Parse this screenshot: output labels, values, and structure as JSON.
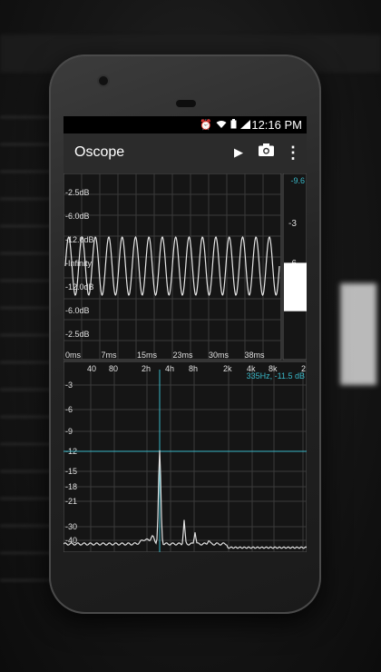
{
  "status_bar": {
    "time": "12:16 PM",
    "icons": [
      "alarm-icon",
      "wifi-icon",
      "battery-icon",
      "signal-icon"
    ]
  },
  "app_bar": {
    "title": "Oscope",
    "actions": [
      {
        "name": "play-icon",
        "glyph": "▶"
      },
      {
        "name": "camera-icon",
        "glyph": "📷"
      },
      {
        "name": "overflow-menu-icon",
        "glyph": "⋮"
      }
    ]
  },
  "scope": {
    "amplitude_labels": [
      "-2.5dB",
      "-6.0dB",
      "-12.0dB",
      "-Infinity",
      "-12.0dB",
      "-6.0dB",
      "-2.5dB"
    ],
    "time_labels": [
      "0ms",
      "7ms",
      "15ms",
      "23ms",
      "30ms",
      "38ms"
    ],
    "meter": {
      "top_value": "-9.6",
      "labels": [
        "-3",
        "-6"
      ],
      "level_fraction": 0.52
    }
  },
  "spectrum": {
    "freq_labels": [
      "40",
      "80",
      "2h",
      "4h",
      "8h",
      "2k",
      "4k",
      "8k",
      "2"
    ],
    "db_labels": [
      "-3",
      "-6",
      "-9",
      "-12",
      "-15",
      "-18",
      "-21",
      "-30",
      "-40"
    ],
    "cursor_readout": "335Hz, -11.5 dB",
    "cursor_freq_hz": 335,
    "cursor_level_db": -11.5
  },
  "colors": {
    "accent": "#39b8c8",
    "grid": "#3a3a3a",
    "trace": "#e0e0e0",
    "background": "#151515"
  }
}
